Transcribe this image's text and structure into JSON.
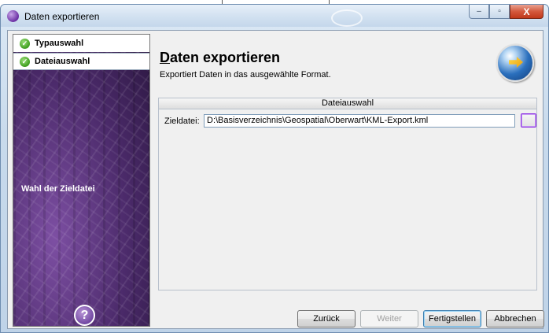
{
  "window": {
    "title": "Daten exportieren",
    "controls": {
      "minimize": "–",
      "maximize": "▫",
      "close": "X"
    }
  },
  "sidebar": {
    "steps": [
      {
        "label": "Typauswahl",
        "state": "completed"
      },
      {
        "label": "Dateiauswahl",
        "state": "completed"
      }
    ],
    "caption": "Wahl der Zieldatei",
    "help": "?"
  },
  "header": {
    "title_u": "D",
    "title_rest": "aten exportieren",
    "subtitle": "Exportiert Daten in das ausgewählte Format."
  },
  "section": {
    "header": "Dateiauswahl",
    "target_label": "Zieldatei:",
    "target_value": "D:\\Basisverzeichnis\\Geospatial\\Oberwart\\KML-Export.kml"
  },
  "buttons": {
    "back": "Zurück",
    "next": "Weiter",
    "finish": "Fertigstellen",
    "cancel": "Abbrechen"
  },
  "colors": {
    "accent": "#6a2fa3",
    "check": "#3e9d1e"
  },
  "icons": {
    "app": "purple-orb-icon",
    "step_done": "checkmark-icon",
    "export": "globe-export-icon",
    "help": "question-icon",
    "browse": "browse-icon"
  }
}
